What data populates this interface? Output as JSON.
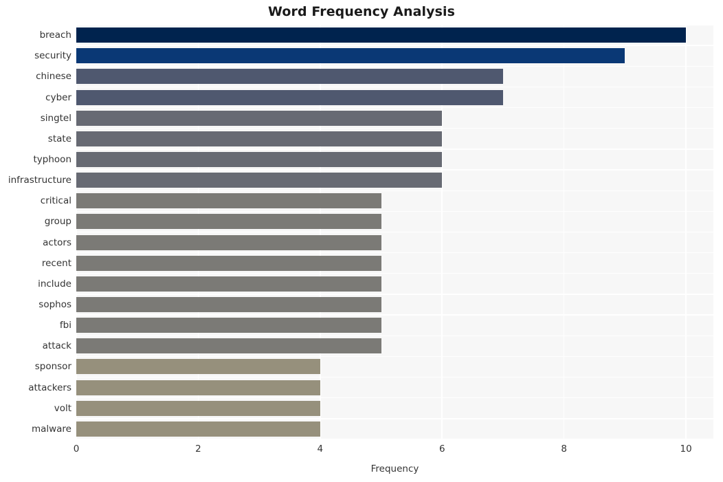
{
  "chart_data": {
    "type": "bar",
    "orientation": "horizontal",
    "title": "Word Frequency Analysis",
    "xlabel": "Frequency",
    "ylabel": "",
    "categories": [
      "breach",
      "security",
      "chinese",
      "cyber",
      "singtel",
      "state",
      "typhoon",
      "infrastructure",
      "critical",
      "group",
      "actors",
      "recent",
      "include",
      "sophos",
      "fbi",
      "attack",
      "sponsor",
      "attackers",
      "volt",
      "malware"
    ],
    "values": [
      10,
      9,
      7,
      7,
      6,
      6,
      6,
      6,
      5,
      5,
      5,
      5,
      5,
      5,
      5,
      5,
      4,
      4,
      4,
      4
    ],
    "bar_colors": [
      "#00234e",
      "#0a3875",
      "#4f586f",
      "#4f586f",
      "#676a73",
      "#676a73",
      "#676a73",
      "#676a73",
      "#7b7a76",
      "#7b7a76",
      "#7b7a76",
      "#7b7a76",
      "#7b7a76",
      "#7b7a76",
      "#7b7a76",
      "#7b7a76",
      "#96907c",
      "#96907c",
      "#96907c",
      "#96907c"
    ],
    "xlim": [
      0,
      10.45
    ],
    "xticks": [
      0,
      2,
      4,
      6,
      8,
      10
    ],
    "xtick_labels": [
      "0",
      "2",
      "4",
      "6",
      "8",
      "10"
    ],
    "grid": true,
    "grid_color": "#ffffff",
    "plot_background": "#f7f7f7",
    "figure_background": "#ffffff",
    "legend": null
  }
}
